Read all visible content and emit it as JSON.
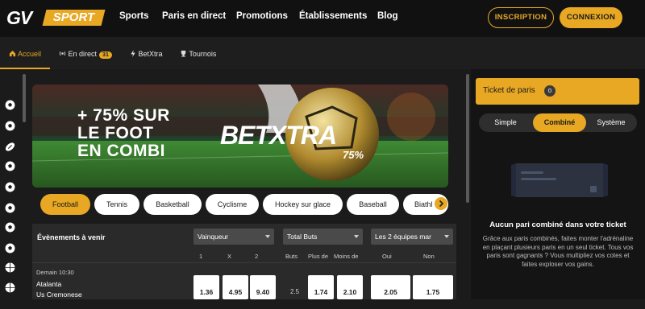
{
  "header": {
    "logo_left": "GV",
    "logo_right": "SPORT",
    "nav": [
      "Sports",
      "Paris en direct",
      "Promotions",
      "Établissements",
      "Blog"
    ],
    "signup_label": "INSCRIPTION",
    "login_label": "CONNEXION"
  },
  "subnav": {
    "home": "Accueil",
    "live": "En direct",
    "live_count": "31",
    "betxtra": "BetXtra",
    "tournaments": "Tournois"
  },
  "banner": {
    "line1": "+ 75% SUR",
    "line2": "LE FOOT",
    "line3": "EN COMBI",
    "brand": "BETXTRA",
    "percent": "75%"
  },
  "sports": [
    "Football",
    "Tennis",
    "Basketball",
    "Cyclisme",
    "Hockey sur glace",
    "Baseball",
    "Biathl"
  ],
  "events": {
    "title": "Évènements à venir",
    "market1": "Vainqueur",
    "market2": "Total Buts",
    "market3": "Les 2 équipes mar",
    "col_1": "1",
    "col_x": "X",
    "col_2": "2",
    "col_buts": "Buts",
    "col_plus": "Plus de",
    "col_moins": "Moins de",
    "col_oui": "Oui",
    "col_non": "Non",
    "match": {
      "time": "Demain 10:30",
      "home": "Atalanta",
      "away": "Us Cremonese",
      "odd1": "1.36",
      "oddx": "4.95",
      "odd2": "9.40",
      "buts": "2.5",
      "plus": "1.74",
      "moins": "2.10",
      "oui": "2.05",
      "non": "1.75"
    }
  },
  "ticket": {
    "label": "Ticket de paris",
    "count": "0",
    "tabs": [
      "Simple",
      "Combiné",
      "Système"
    ],
    "empty_title": "Aucun pari combiné dans votre ticket",
    "empty_text": "Grâce aux paris combinés, faites monter l'adrénaline en plaçant plusieurs paris en un seul ticket. Tous vos paris sont gagnants ? Vous multipliez vos cotes et faites exploser vos gains."
  },
  "colors": {
    "accent": "#e8a824",
    "bg": "#1b1b1b"
  }
}
